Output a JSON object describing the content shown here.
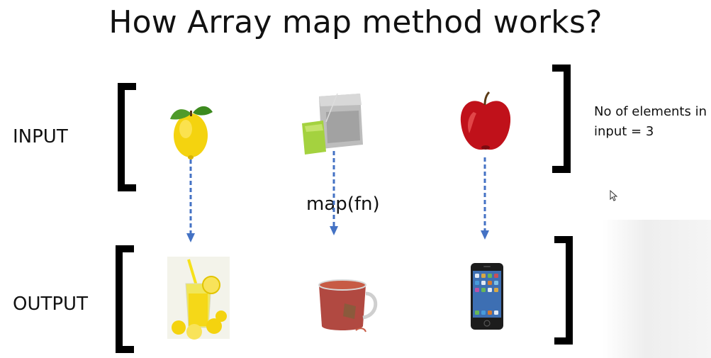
{
  "title": "How Array map method works?",
  "input_label": "INPUT",
  "output_label": "OUTPUT",
  "map_label": "map(fn)",
  "note": {
    "line1": "No of elements in",
    "line2": "input = 3"
  },
  "inputs": [
    {
      "icon": "lemon-icon"
    },
    {
      "icon": "tea-bag-icon"
    },
    {
      "icon": "apple-icon"
    }
  ],
  "outputs": [
    {
      "icon": "lemonade-icon"
    },
    {
      "icon": "tea-cup-icon"
    },
    {
      "icon": "iphone-icon"
    }
  ],
  "colors": {
    "arrow": "#4472c4",
    "bracket": "#000000"
  }
}
